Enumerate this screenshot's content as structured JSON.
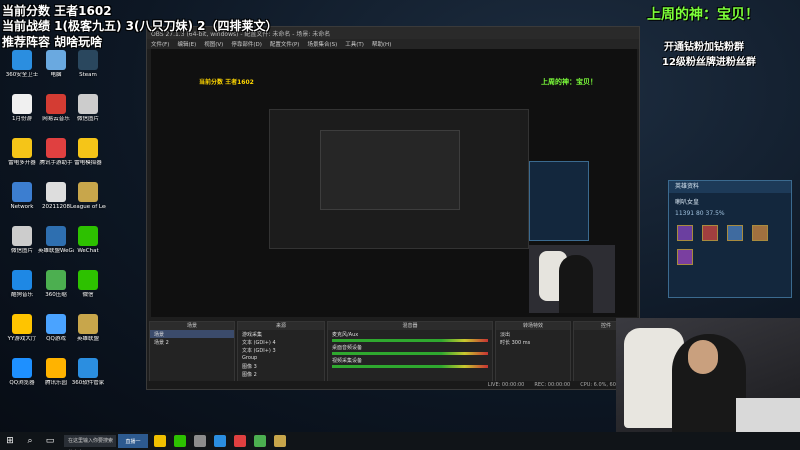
{
  "overlay": {
    "line1": "当前分数 王者1602",
    "line2": "当前战绩 1(极客九五) 3(八只刀妹) 2（四排莱文）",
    "line3": "推荐阵容 胡啥玩啥",
    "god_title": "上周的神：宝贝！",
    "fan1": "开通钻粉加钻粉群",
    "fan2": "12级粉丝牌进粉丝群"
  },
  "desktop_icons": [
    {
      "label": "360安全卫士",
      "color": "#2b8ee0"
    },
    {
      "label": "电脑",
      "color": "#6aa9e0"
    },
    {
      "label": "Steam",
      "color": "#2a475e"
    },
    {
      "label": "1月份游",
      "color": "#f0f0f0"
    },
    {
      "label": "网易云音乐",
      "color": "#d43c33"
    },
    {
      "label": "微信图片",
      "color": "#cccccc"
    },
    {
      "label": "雷电多开器",
      "color": "#f5c518"
    },
    {
      "label": "腾讯手游助手",
      "color": "#e04040"
    },
    {
      "label": "雷电模拟器",
      "color": "#f5c518"
    },
    {
      "label": "Network",
      "color": "#3c7ed0"
    },
    {
      "label": "20211208",
      "color": "#dddddd"
    },
    {
      "label": "League of Legends",
      "color": "#c8a64b"
    },
    {
      "label": "微信图片",
      "color": "#cccccc"
    },
    {
      "label": "英雄联盟WeGame",
      "color": "#2e6fb0"
    },
    {
      "label": "WeChat",
      "color": "#2dc100"
    },
    {
      "label": "酷狗音乐",
      "color": "#1e88e5"
    },
    {
      "label": "360压缩",
      "color": "#4caf50"
    },
    {
      "label": "微信",
      "color": "#2dc100"
    },
    {
      "label": "YY游戏大厅",
      "color": "#ffc400"
    },
    {
      "label": "QQ游戏",
      "color": "#4aa3ff"
    },
    {
      "label": "英雄联盟",
      "color": "#c8a64b"
    },
    {
      "label": "QQ浏览器",
      "color": "#1e90ff"
    },
    {
      "label": "腾讯乐园",
      "color": "#ffb300"
    },
    {
      "label": "360软件管家",
      "color": "#2b8ee0"
    }
  ],
  "obs": {
    "title": "OBS 27.1.3 (64-bit, windows) - 配置文件: 未命名 - 场景: 未命名",
    "menus": [
      "文件(F)",
      "编辑(E)",
      "视图(V)",
      "停靠部件(D)",
      "配置文件(P)",
      "场景集合(S)",
      "工具(T)",
      "帮助(H)"
    ],
    "panels": {
      "scenes": {
        "header": "场景",
        "items": [
          "场景",
          "场景 2"
        ]
      },
      "sources": {
        "header": "来源",
        "items": [
          "游戏采集",
          "文本 (GDI+) 4",
          "文本 (GDI+) 3",
          "Group",
          "图像 3",
          "图像 2"
        ]
      },
      "mixer": {
        "header": "混音器",
        "items": [
          "麦克风/Aux",
          "桌面音频设备",
          "视频采集设备"
        ]
      },
      "transitions": {
        "header": "转场特效",
        "items": [
          "淡出",
          "时长 300 ms"
        ]
      },
      "controls": {
        "header": "控件"
      }
    },
    "status": {
      "live": "LIVE: 00:00:00",
      "rec": "REC: 00:00:00",
      "cpu": "CPU: 6.0%, 60.00 fps"
    }
  },
  "game_panel": {
    "title": "英雄资料",
    "player": "喇叭女皇",
    "stats": "11391   80   37.5%"
  },
  "taskbar": {
    "search": "在这里输入你要搜索的内容",
    "app": "直播一"
  }
}
